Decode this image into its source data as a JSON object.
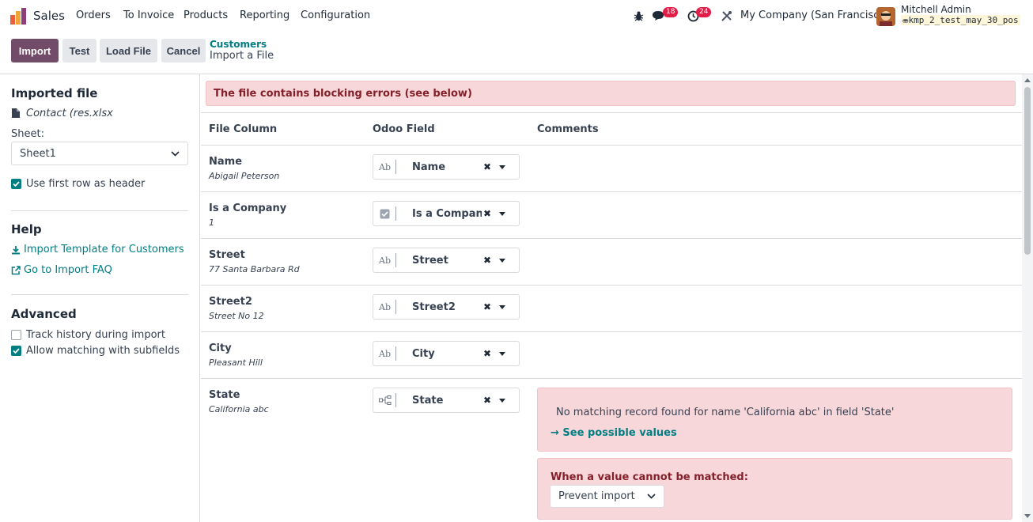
{
  "navbar": {
    "app_name": "Sales",
    "menus": [
      "Orders",
      "To Invoice",
      "Products",
      "Reporting",
      "Configuration"
    ],
    "messages_badge": "18",
    "activities_badge": "24",
    "company": "My Company (San Francisco)",
    "user_name": "Mitchell Admin",
    "db_name": "kmp_2_test_may_30_pos"
  },
  "control": {
    "import_label": "Import",
    "test_label": "Test",
    "load_file_label": "Load File",
    "cancel_label": "Cancel",
    "breadcrumb_parent": "Customers",
    "breadcrumb_current": "Import a File"
  },
  "sidebar": {
    "imported_file_heading": "Imported file",
    "file_name": "Contact (res.xlsx",
    "sheet_label": "Sheet:",
    "sheet_value": "Sheet1",
    "first_row_header_label": "Use first row as header",
    "first_row_header_checked": true,
    "help_heading": "Help",
    "template_link": "Import Template for Customers",
    "faq_link": "Go to Import FAQ",
    "advanced_heading": "Advanced",
    "track_history_label": "Track history during import",
    "track_history_checked": false,
    "allow_matching_label": "Allow matching with subfields",
    "allow_matching_checked": true
  },
  "main": {
    "blocking_error": "The file contains blocking errors (see below)",
    "headers": {
      "file_column": "File Column",
      "odoo_field": "Odoo Field",
      "comments": "Comments"
    },
    "rows": [
      {
        "name": "Name",
        "sample": "Abigail Peterson",
        "field": "Name",
        "type_icon": "text-icon"
      },
      {
        "name": "Is a Company",
        "sample": "1",
        "field": "Is a Company",
        "type_icon": "checkbox-icon"
      },
      {
        "name": "Street",
        "sample": "77 Santa Barbara Rd",
        "field": "Street",
        "type_icon": "text-icon"
      },
      {
        "name": "Street2",
        "sample": "Street No 12",
        "field": "Street2",
        "type_icon": "text-icon"
      },
      {
        "name": "City",
        "sample": "Pleasant Hill",
        "field": "City",
        "type_icon": "text-icon"
      },
      {
        "name": "State",
        "sample": "California abc",
        "field": "State",
        "type_icon": "relation-icon"
      }
    ],
    "state_error": {
      "message": "No matching record found for name 'California abc' in field 'State'",
      "see_values_link": "→ See possible values",
      "unmatched_heading": "When a value cannot be matched:",
      "unmatched_option": "Prevent import"
    }
  },
  "colors": {
    "brand_primary": "#714b67",
    "link": "#017e84",
    "error_bg": "#f8d7da",
    "error_text": "#842029",
    "badge": "#e11d48"
  }
}
